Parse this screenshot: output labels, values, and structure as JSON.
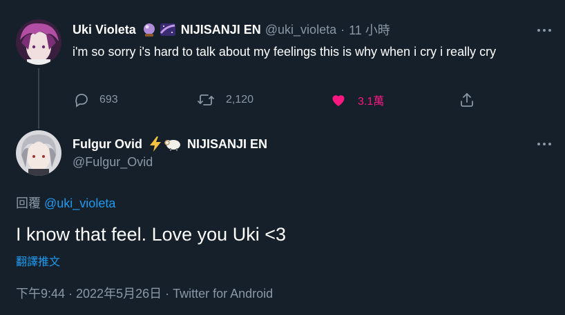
{
  "tweet1": {
    "author_name": "Uki Violeta",
    "emoji1": "🔮",
    "emoji2": "🌌",
    "affiliation": "NIJISANJI EN",
    "handle": "@uki_violeta",
    "separator": "·",
    "time": "11 小時",
    "text": "i'm so sorry i's hard to talk about my feelings this is why when i cry i really cry",
    "actions": {
      "reply_count": "693",
      "retweet_count": "2,120",
      "like_count": "3.1萬"
    },
    "icons": [
      "reply-icon",
      "retweet-icon",
      "heart-icon",
      "share-icon",
      "more-icon"
    ]
  },
  "tweet2": {
    "author_name": "Fulgur Ovid",
    "emoji1": "⚡",
    "emoji2": "🐏",
    "affiliation": "NIJISANJI EN",
    "handle": "@Fulgur_Ovid",
    "replying_prefix": "回覆",
    "replying_to": "@uki_violeta",
    "text": "I know that feel. Love you Uki <3",
    "translate_label": "翻譯推文",
    "footer": "下午9:44 · 2022年5月26日 · Twitter for Android"
  },
  "colors": {
    "background": "#15202b",
    "muted": "#8b98a5",
    "accent": "#1d9bf0",
    "like": "#f91880"
  }
}
